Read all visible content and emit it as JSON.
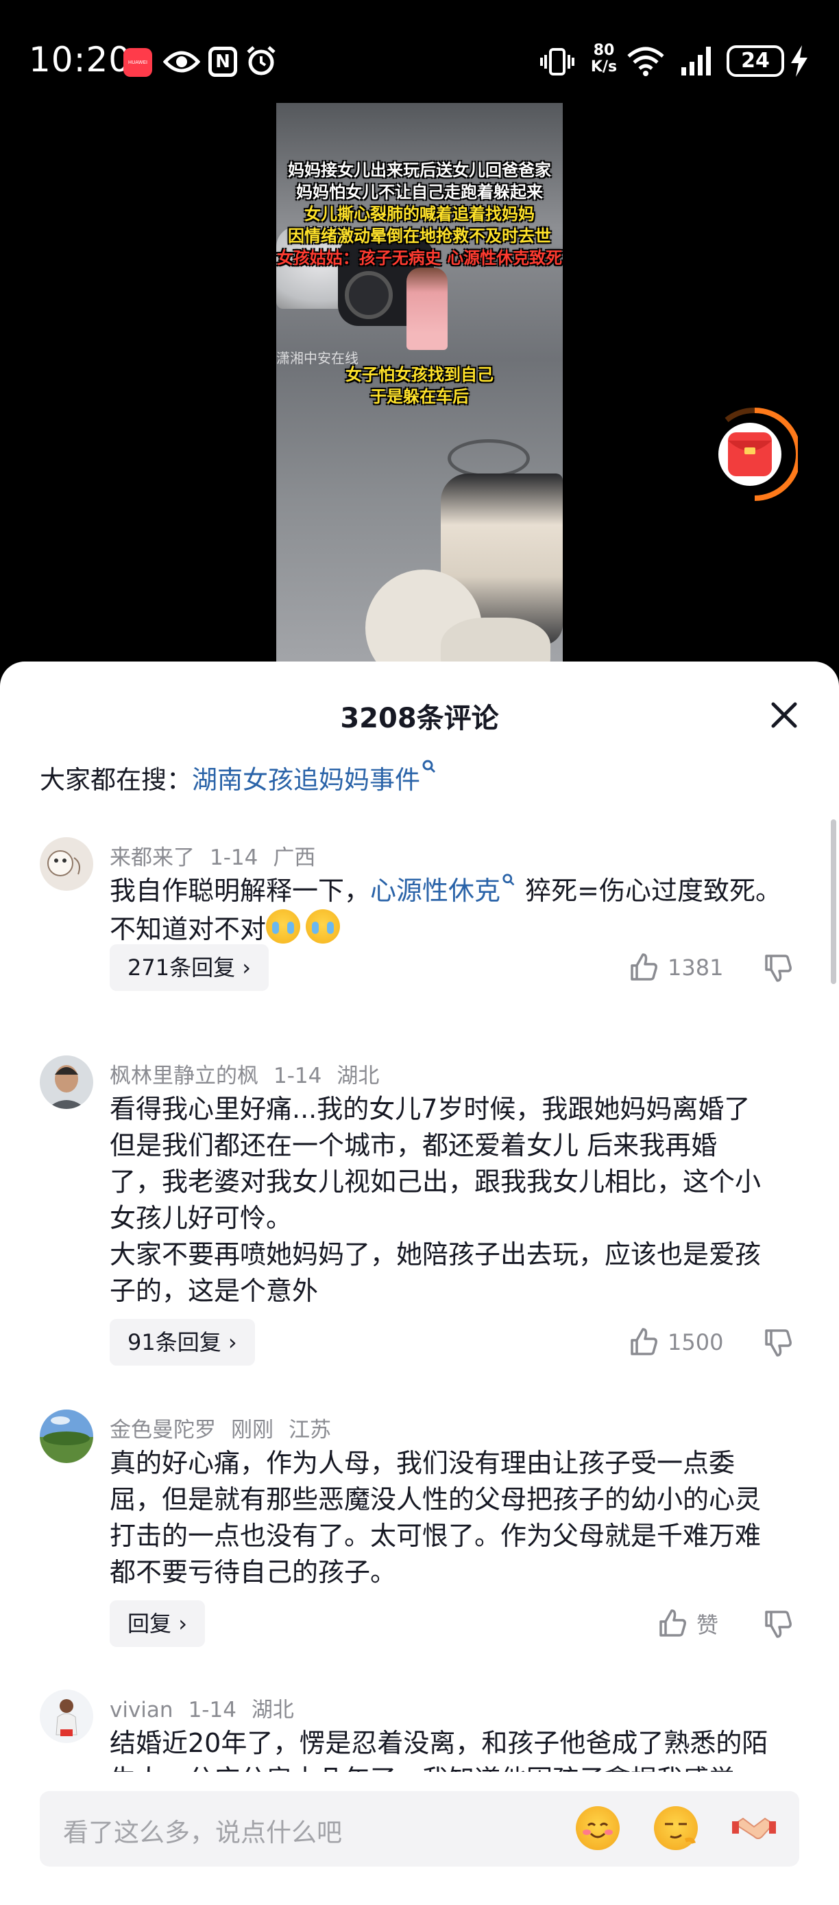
{
  "status_bar": {
    "time": "10:20",
    "carrier_badge": "HUAWEI",
    "nfc": "N",
    "net_speed_value": "80",
    "net_speed_unit": "K/s",
    "battery": "24",
    "icons": [
      "huawei-app-icon",
      "eye-icon",
      "nfc-icon",
      "alarm-icon",
      "vibrate-icon",
      "wifi-icon",
      "signal-icon",
      "battery-icon",
      "charging-icon"
    ]
  },
  "video": {
    "captions": [
      "妈妈接女儿出来玩后送女儿回爸爸家",
      "妈妈怕女儿不让自己走跑着躲起来",
      "女儿撕心裂肺的喊着追着找妈妈",
      "因情绪激动晕倒在地抢救不及时去世",
      "女孩姑姑：孩子无病史 心源性休克致死"
    ],
    "subtitle_lines": [
      "女子怕女孩找到自己",
      "于是躲在车后"
    ],
    "watermark": "潇湘中安在线"
  },
  "comments_sheet": {
    "title": "3208条评论",
    "search_prefix": "大家都在搜：",
    "search_link": "湖南女孩追妈妈事件",
    "comments": [
      {
        "user": "来都来了",
        "date": "1-14",
        "location": "广西",
        "text_before": "我自作聪明解释一下，",
        "highlight": "心源性休克",
        "text_after": " 猝死=伤心过度致死。不知道对不对",
        "replies": "271条回复",
        "likes": "1381"
      },
      {
        "user": "枫林里静立的枫",
        "date": "1-14",
        "location": "湖北",
        "text_lines": [
          "看得我心里好痛...我的女儿7岁时候，我跟她妈妈离婚了",
          "但是我们都还在一个城市，都还爱着女儿 后来我再婚",
          "了，我老婆对我女儿视如己出，跟我我女儿相比，这个小",
          "女孩儿好可怜。",
          "大家不要再喷她妈妈了，她陪孩子出去玩，应该也是爱孩",
          "子的，这是个意外"
        ],
        "replies": "91条回复",
        "likes": "1500"
      },
      {
        "user": "金色曼陀罗",
        "date": "刚刚",
        "location": "江苏",
        "text_lines": [
          "真的好心痛，作为人母，我们没有理由让孩子受一点委",
          "屈，但是就有那些恶魔没人性的父母把孩子的幼小的心灵",
          "打击的一点也没有了。太可恨了。作为父母就是千难万难",
          "都不要亏待自己的孩子。"
        ],
        "replies": "回复",
        "likes": "赞"
      },
      {
        "user": "vivian",
        "date": "1-14",
        "location": "湖北",
        "text_lines": [
          "结婚近20年了，愣是忍着没离，和孩子他爸成了熟悉的陌",
          "生人，分床分房十几年了，我知道他因孩子拿捏我感觉"
        ]
      }
    ]
  },
  "input": {
    "placeholder": "看了这么多，说点什么吧"
  }
}
